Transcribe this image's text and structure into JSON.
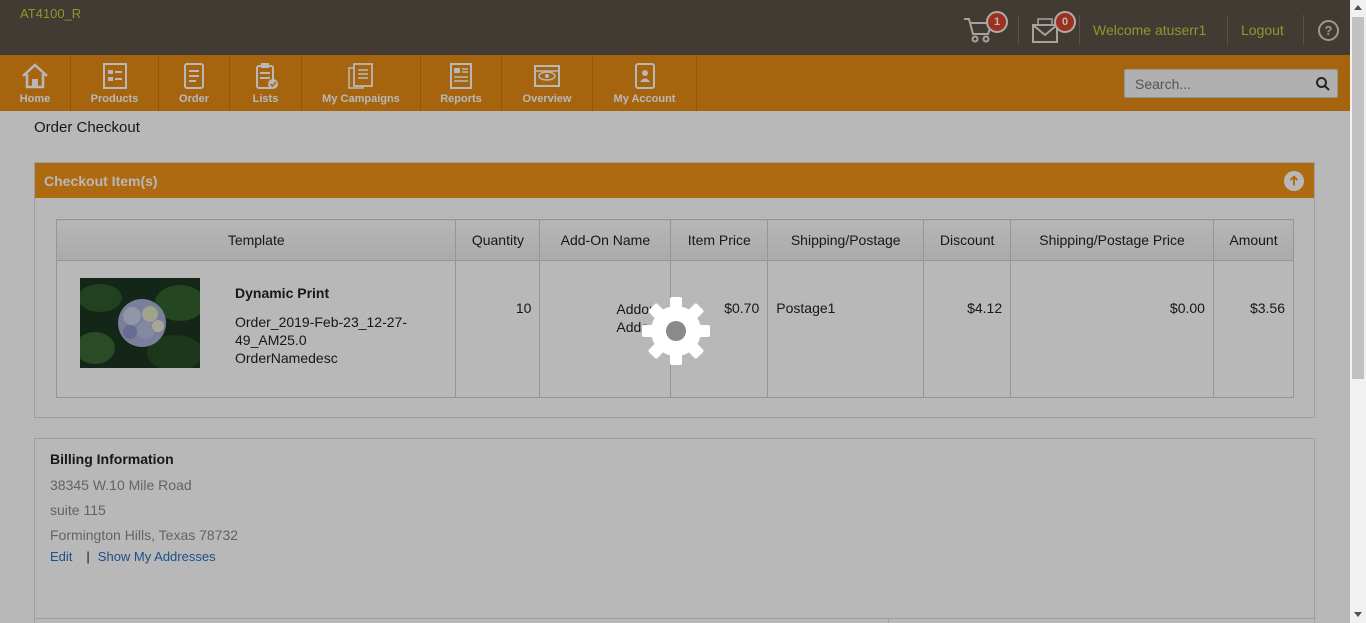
{
  "header": {
    "brand": "AT4100_R",
    "cart_count": "1",
    "messages_count": "0",
    "welcome": "Welcome atuserr1",
    "logout": "Logout",
    "help": "?"
  },
  "nav": {
    "items": [
      {
        "label": "Home",
        "icon": "home-icon"
      },
      {
        "label": "Products",
        "icon": "products-icon"
      },
      {
        "label": "Order",
        "icon": "order-icon"
      },
      {
        "label": "Lists",
        "icon": "lists-icon"
      },
      {
        "label": "My Campaigns",
        "icon": "campaigns-icon"
      },
      {
        "label": "Reports",
        "icon": "reports-icon"
      },
      {
        "label": "Overview",
        "icon": "overview-icon"
      },
      {
        "label": "My Account",
        "icon": "account-icon"
      }
    ],
    "search_placeholder": "Search..."
  },
  "page": {
    "title": "Order Checkout",
    "checkout_title": "Checkout Item(s)"
  },
  "table": {
    "headers": [
      "Template",
      "Quantity",
      "Add-On Name",
      "Item Price",
      "Shipping/Postage",
      "Discount",
      "Shipping/Postage Price",
      "Amount"
    ],
    "row": {
      "template_name": "Dynamic Print",
      "template_desc_1": "Order_2019-Feb-23_12-27-",
      "template_desc_2": "49_AM25.0",
      "template_desc_3": "OrderNamedesc",
      "quantity": "10",
      "addon_1": "Addon",
      "addon_2": "Addo",
      "item_price": "$0.70",
      "shipping": "Postage1",
      "discount": "$4.12",
      "shipping_price": "$0.00",
      "amount": "$3.56"
    }
  },
  "billing": {
    "title": "Billing Information",
    "line1": "38345 W.10 Mile Road",
    "line2": "suite 115",
    "line3": "Formington Hills, Texas 78732",
    "edit": "Edit",
    "separator": "|",
    "show_addresses": "Show My Addresses"
  },
  "colors": {
    "topbar": "#5a5249",
    "nav": "#e88b14",
    "accent_text": "#c6d33a",
    "panel_head": "#f29418"
  }
}
